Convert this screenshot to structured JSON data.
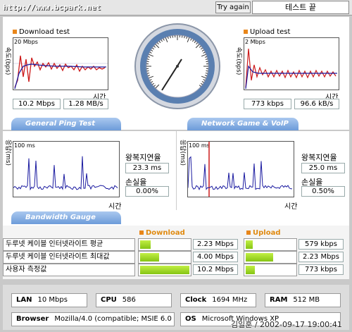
{
  "header": {
    "url": "http://www.bcpark.net",
    "try_again": "Try again",
    "status": "테스트 끝"
  },
  "download": {
    "title": "Download test",
    "ylabel": "속도(bps)",
    "ymax": "20 Mbps",
    "xlabel": "시간",
    "mbps": "10.2 Mbps",
    "mbs": "1.28 MB/s"
  },
  "upload": {
    "title": "Upload test",
    "ylabel": "속도(bps)",
    "ymax": "2 Mbps",
    "xlabel": "시간",
    "kbps": "773 kbps",
    "kbs": "96.6 kB/s"
  },
  "sections": {
    "ping": "General Ping Test",
    "game": "Network Game & VoIP Test",
    "gauge": "Bandwidth Gauge"
  },
  "ping1": {
    "ylabel": "응답(ms)",
    "ymax": "100 ms",
    "xlabel": "시간",
    "rtt_label": "왕복지연율",
    "rtt": "23.3 ms",
    "loss_label": "손실율",
    "loss": "0.00%"
  },
  "ping2": {
    "ylabel": "응답(ms)",
    "ymax": "100 ms",
    "xlabel": "시간",
    "rtt_label": "왕복지연율",
    "rtt": "25.0 ms",
    "loss_label": "손실율",
    "loss": "0.50%"
  },
  "gauge": {
    "download_label": "Download",
    "upload_label": "Upload",
    "rows": [
      {
        "label": "두루넷 케이블 인터넷라이트 평균",
        "down": "2.23 Mbps",
        "down_frac": 0.22,
        "up": "579 kbps",
        "up_frac": 0.14
      },
      {
        "label": "두루넷 케이블 인터넷라이트 최대값",
        "down": "4.00 Mbps",
        "down_frac": 0.39,
        "up": "2.23 Mbps",
        "up_frac": 0.55
      },
      {
        "label": "사용자 측정값",
        "down": "10.2 Mbps",
        "down_frac": 1.0,
        "up": "773 kbps",
        "up_frac": 0.19
      }
    ]
  },
  "sysinfo": {
    "lan_label": "LAN",
    "lan": "10 Mbps",
    "cpu_label": "CPU",
    "cpu": "586",
    "clock_label": "Clock",
    "clock": "1694 MHz",
    "ram_label": "RAM",
    "ram": "512 MB",
    "browser_label": "Browser",
    "browser": "Mozilla/4.0 (compatible; MSIE 6.0",
    "os_label": "OS",
    "os": "Microsoft Windows XP"
  },
  "stamp": "김일훈 / 2002-09-17 19:00:41",
  "colors": {
    "download_line": "#1a1aa0",
    "download_peak": "#cc1a1a",
    "ping_line": "#1a1aa0",
    "marker": "#cc1a1a",
    "banner": "#6c9bd9",
    "bar": "#9ad624"
  }
}
